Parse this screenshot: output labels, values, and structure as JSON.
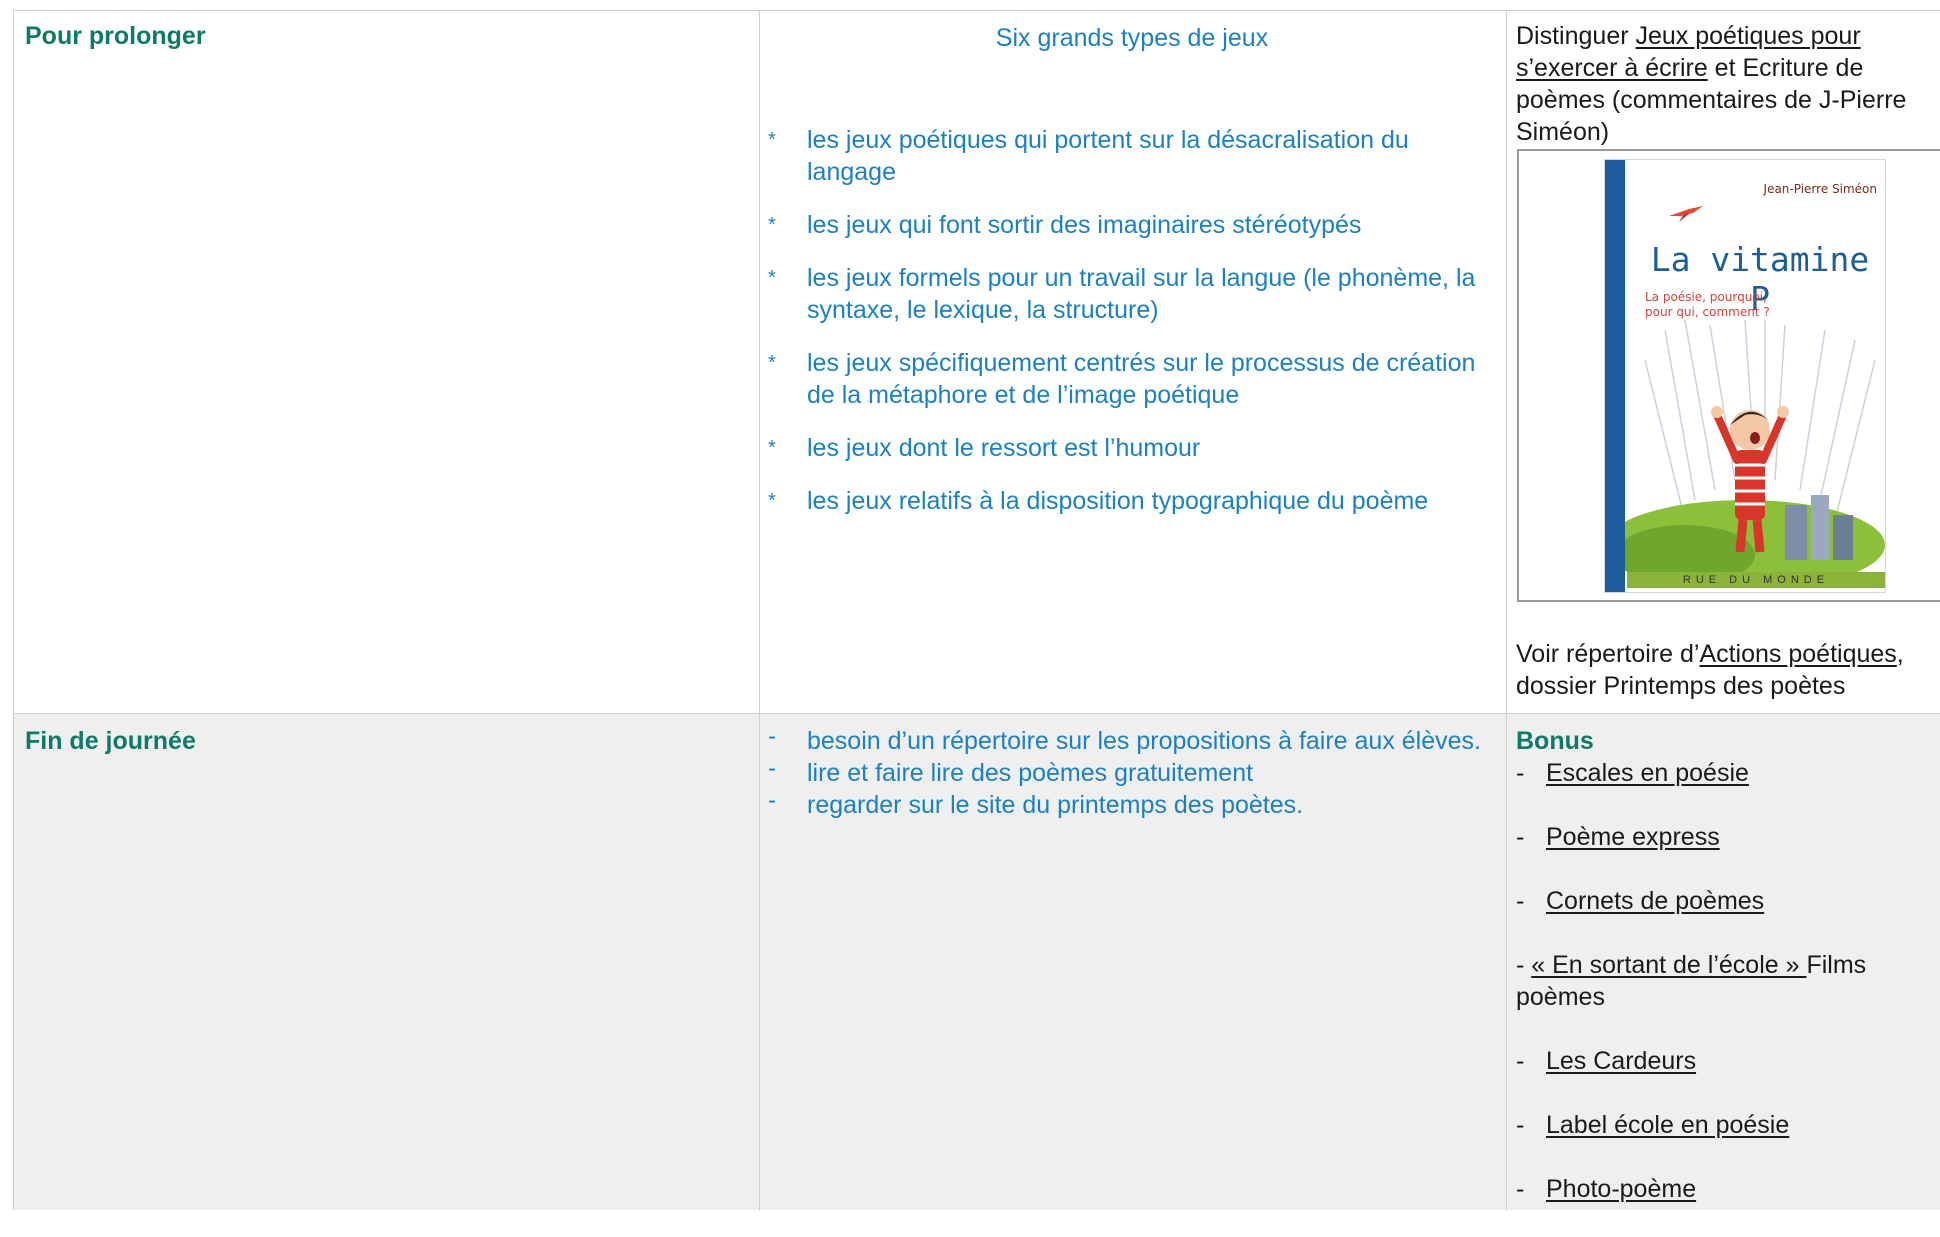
{
  "rows": [
    {
      "label": "Pour prolonger",
      "middle": {
        "heading": "Six grands types de jeux",
        "bullet": "*",
        "items": [
          "les jeux poétiques qui portent sur la désacralisation du langage",
          "les jeux qui font sortir des imaginaires stéréotypés",
          "les jeux formels pour un travail sur la langue (le phonème, la syntaxe, le lexique, la structure)",
          "les jeux spécifiquement centrés sur le processus de création de la métaphore et de l’image poétique",
          "les jeux dont le ressort est l’humour",
          "les jeux relatifs à la disposition typographique du poème"
        ]
      },
      "right": {
        "intro_prefix": "Distinguer ",
        "intro_link": "Jeux poétiques pour s’exercer à écrire",
        "intro_suffix": " et Ecriture de poèmes (commentaires de J-Pierre Siméon)",
        "book": {
          "author": "Jean-Pierre Siméon",
          "title": "La vitamine P",
          "subtitle_line1": "La poésie, pourquoi,",
          "subtitle_line2": "pour qui, comment ?",
          "publisher": "RUE DU MONDE"
        },
        "outro_prefix": "Voir répertoire d’",
        "outro_link": "Actions poétiques",
        "outro_suffix": ", dossier Printemps des poètes"
      }
    },
    {
      "label": "Fin de journée",
      "middle": {
        "bullet": "-",
        "items": [
          "besoin d’un répertoire sur les propositions à faire aux élèves.",
          "lire et faire lire des poèmes gratuitement",
          "regarder sur le site du printemps des poètes."
        ]
      },
      "right": {
        "heading": "Bonus",
        "dash": "-",
        "items": [
          "Escales en poésie",
          "Poème express",
          "Cornets de poèmes"
        ],
        "film_prefix": "- ",
        "film_link": "« En sortant de l’école » ",
        "film_suffix": "Films poèmes",
        "items2": [
          "Les Cardeurs",
          "Label école en poésie",
          "Photo-poème"
        ]
      }
    }
  ],
  "colors": {
    "label": "#0e7b66",
    "blue_text": "#1b80c4",
    "row2_bg": "#efefef",
    "grid": "#cfcfcf"
  }
}
